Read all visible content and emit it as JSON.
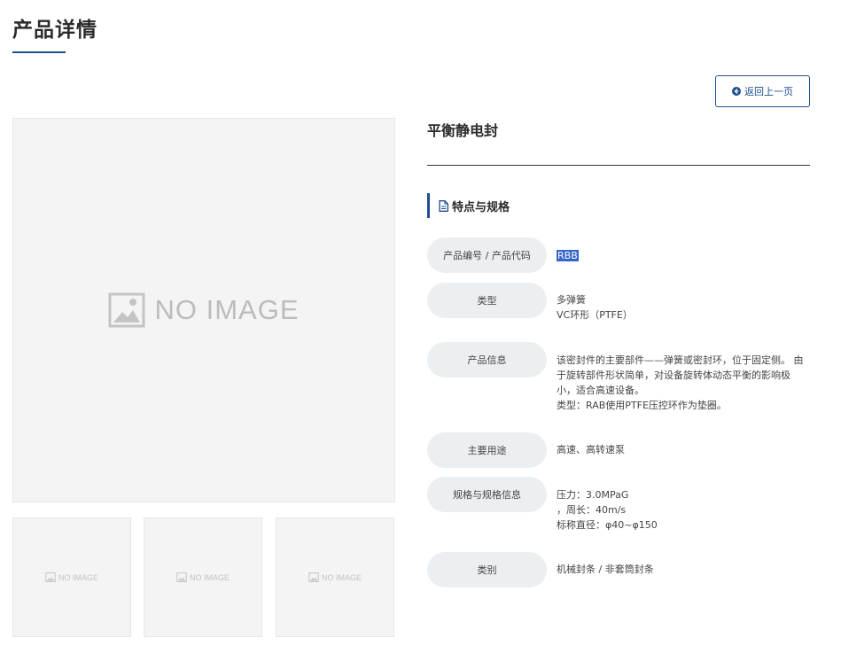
{
  "page": {
    "title": "产品详情"
  },
  "back_button": {
    "label": "返回上一页",
    "icon": "arrow-circle-left-icon"
  },
  "gallery": {
    "main_placeholder": "NO IMAGE",
    "thumbnails": [
      "NO IMAGE",
      "NO IMAGE",
      "NO IMAGE"
    ],
    "icon": "image-placeholder-icon"
  },
  "product": {
    "name": "平衡静电封"
  },
  "section": {
    "title": "特点与规格",
    "icon": "document-icon"
  },
  "specs": [
    {
      "label": "产品编号 / 产品代码",
      "lines": [
        "RBB"
      ]
    },
    {
      "label": "类型",
      "lines": [
        "多弹簧",
        "VC环形（PTFE）"
      ]
    },
    {
      "label": "产品信息",
      "lines": [
        "该密封件的主要部件——弹簧或密封环，位于固定侧。 由",
        "于旋转部件形状简单，对设备旋转体动态平衡的影响极",
        "小，适合高速设备。",
        "类型：RAB使用PTFE压控环作为垫圈。"
      ]
    },
    {
      "label": "主要用途",
      "lines": [
        "高速、高转速泵"
      ]
    },
    {
      "label": "规格与规格信息",
      "lines": [
        "压力：3.0MPaG",
        "，周长：40m/s",
        "标称直径：φ40~φ150"
      ]
    },
    {
      "label": "类别",
      "lines": [
        "机械封条 / 非套筒封条"
      ]
    }
  ],
  "colors": {
    "accent": "#1f4e8c",
    "label_bg": "#eceff2",
    "placeholder_bg": "#f4f4f4",
    "selection": "#3366cc"
  }
}
